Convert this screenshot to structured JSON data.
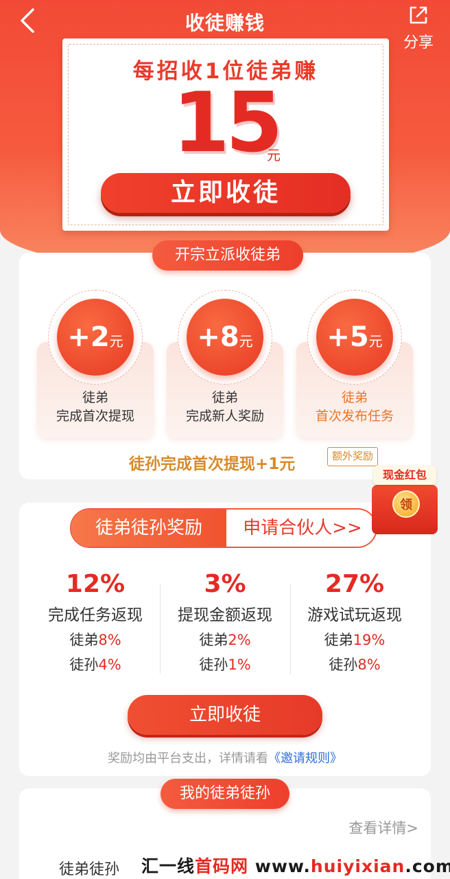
{
  "header": {
    "title": "收徒赚钱",
    "share_label": "分享"
  },
  "hero": {
    "headline": "每招收1位徒弟赚",
    "amount": "15",
    "unit": "元",
    "cta": "立即收徒"
  },
  "rewards_section": {
    "title": "开宗立派收徒弟",
    "items": [
      {
        "value": "+2",
        "unit": "元",
        "line1": "徒弟",
        "line2": "完成首次提现"
      },
      {
        "value": "+8",
        "unit": "元",
        "line1": "徒弟",
        "line2": "完成新人奖励"
      },
      {
        "value": "+5",
        "unit": "元",
        "line1": "徒弟",
        "line2": "首次发布任务"
      }
    ],
    "extra_text": "徒孙完成首次提现+1元",
    "extra_badge": "额外奖励"
  },
  "coupon": {
    "label": "现金红包",
    "button": "领"
  },
  "commission": {
    "tab_active": "徒弟徒孙奖励",
    "tab_partner": "申请合伙人>>",
    "columns": [
      {
        "percent": "12%",
        "label": "完成任务返现",
        "disciple_label": "徒弟",
        "disciple_rate": "8%",
        "grand_label": "徒孙",
        "grand_rate": "4%"
      },
      {
        "percent": "3%",
        "label": "提现金额返现",
        "disciple_label": "徒弟",
        "disciple_rate": "2%",
        "grand_label": "徒孙",
        "grand_rate": "1%"
      },
      {
        "percent": "27%",
        "label": "游戏试玩返现",
        "disciple_label": "徒弟",
        "disciple_rate": "19%",
        "grand_label": "徒孙",
        "grand_rate": "8%"
      }
    ],
    "cta": "立即收徒",
    "note": "奖励均由平台支出，详情请看",
    "rules_link": "《邀请规则》"
  },
  "my_disciples": {
    "title": "我的徒弟徒孙",
    "details_link": "查看详情>",
    "bottom_left": "徒弟徒孙"
  },
  "watermark": {
    "part1": "汇一线",
    "part2": "首码网",
    "part3": " www.",
    "part4": "huiyixian",
    "part5": ".com"
  },
  "colors": {
    "primary_red": "#e32b23",
    "orange_text": "#d88a2a",
    "link_blue": "#2e6fd6"
  }
}
